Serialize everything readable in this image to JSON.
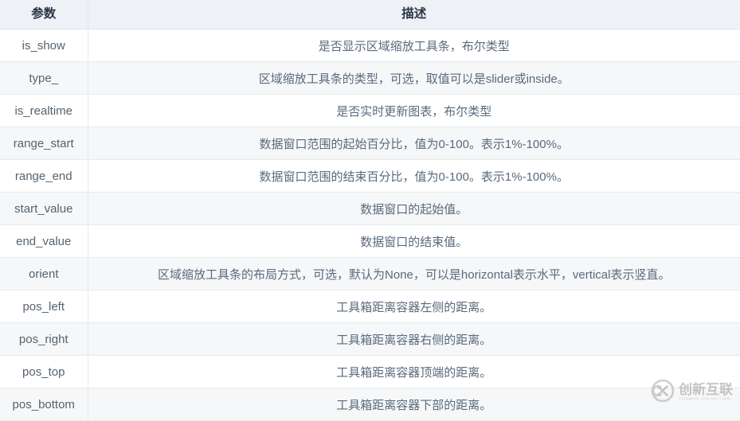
{
  "table": {
    "columns": [
      {
        "key": "name",
        "label": "参数"
      },
      {
        "key": "desc",
        "label": "描述"
      }
    ],
    "rows": [
      {
        "name": "is_show",
        "desc": "是否显示区域缩放工具条，布尔类型"
      },
      {
        "name": "type_",
        "desc": "区域缩放工具条的类型，可选，取值可以是slider或inside。"
      },
      {
        "name": "is_realtime",
        "desc": "是否实时更新图表，布尔类型"
      },
      {
        "name": "range_start",
        "desc": "数据窗口范围的起始百分比，值为0-100。表示1%-100%。"
      },
      {
        "name": "range_end",
        "desc": "数据窗口范围的结束百分比，值为0-100。表示1%-100%。"
      },
      {
        "name": "start_value",
        "desc": "数据窗口的起始值。"
      },
      {
        "name": "end_value",
        "desc": "数据窗口的结束值。"
      },
      {
        "name": "orient",
        "desc": "区域缩放工具条的布局方式，可选，默认为None，可以是horizontal表示水平，vertical表示竖直。"
      },
      {
        "name": "pos_left",
        "desc": "工具箱距离容器左侧的距离。"
      },
      {
        "name": "pos_right",
        "desc": "工具箱距离容器右侧的距离。"
      },
      {
        "name": "pos_top",
        "desc": "工具箱距离容器顶端的距离。"
      },
      {
        "name": "pos_bottom",
        "desc": "工具箱距离容器下部的距离。"
      }
    ]
  },
  "watermark": {
    "brand_cn": "创新互联",
    "brand_en": "CHUANG XIN HU LIAN",
    "mark_letter": "X"
  },
  "colors": {
    "header_bg": "#eef1f6",
    "header_text": "#2b3645",
    "row_alt_bg": "#f6f7f8",
    "row_bg": "#ffffff",
    "border": "#e6eaee",
    "body_text": "#5a6a7d"
  }
}
